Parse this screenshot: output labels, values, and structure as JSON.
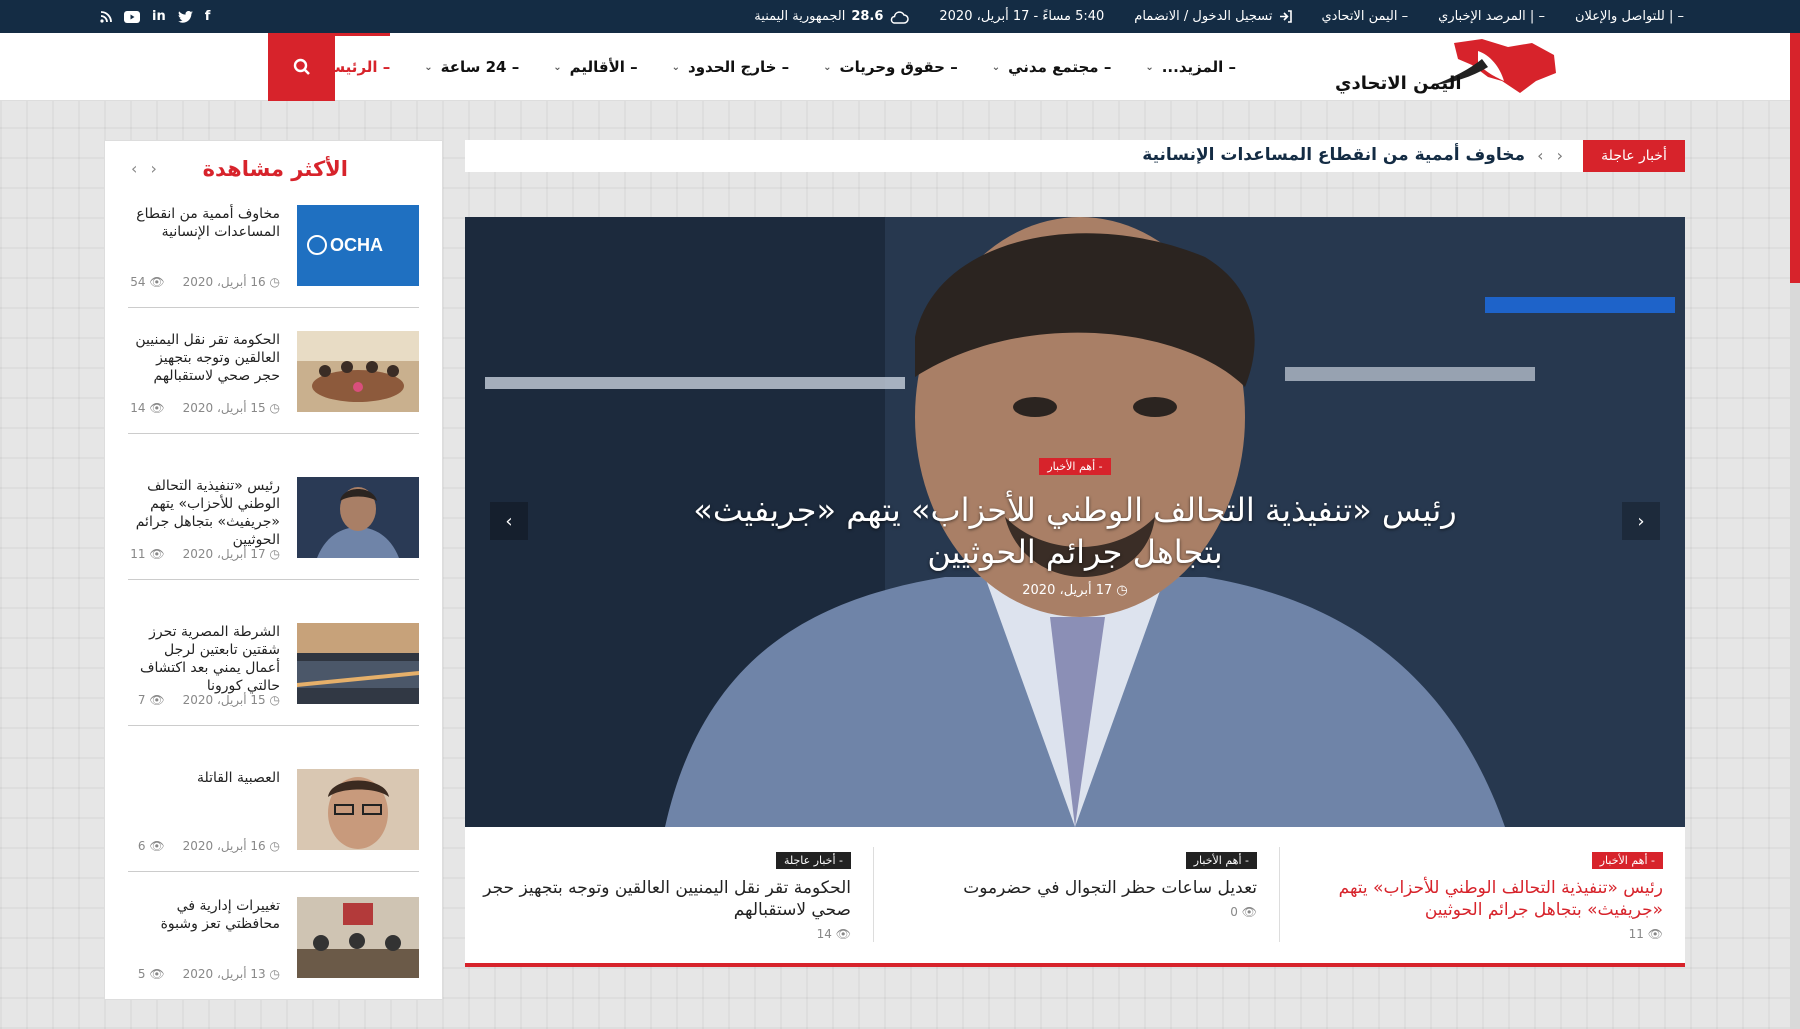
{
  "topbar": {
    "weather": "28.6",
    "region": "الجمهورية اليمنية",
    "datetime": "5:40 مساءً - 17 أبريل، 2020",
    "login": "تسجيل الدخول / الانضمام",
    "links": [
      "– اليمن الاتحادي",
      "– | المرصد الإخباري",
      "– | للتواصل والإعلان"
    ],
    "social_icons": [
      "facebook-icon",
      "twitter-icon",
      "linkedin-icon",
      "youtube-icon",
      "rss-icon"
    ]
  },
  "header": {
    "logo_text": "اليمن الاتحادي",
    "nav": [
      {
        "label": "– الرئيسية",
        "active": true,
        "has_menu": false
      },
      {
        "label": "– 24 ساعة",
        "active": false,
        "has_menu": true
      },
      {
        "label": "– الأقاليم",
        "active": false,
        "has_menu": true
      },
      {
        "label": "– خارج الحدود",
        "active": false,
        "has_menu": true
      },
      {
        "label": "– حقوق وحريات",
        "active": false,
        "has_menu": true
      },
      {
        "label": "– مجتمع مدني",
        "active": false,
        "has_menu": true
      },
      {
        "label": "– المزيد...",
        "active": false,
        "has_menu": true
      }
    ]
  },
  "breaking": {
    "label": "أخبار عاجلة",
    "headline": "مخاوف أممية من انقطاع المساعدات الإنسانية"
  },
  "slider": {
    "category": "- أهم الأخبار",
    "title": "رئيس «تنفيذية التحالف الوطني للأحزاب» يتهم «جريفيث» بتجاهل جرائم الحوثيين",
    "date": "17 أبريل، 2020"
  },
  "strip": [
    {
      "category": "- أهم الأخبار",
      "title": "رئيس «تنفيذية التحالف الوطني للأحزاب» يتهم «جريفيث» بتجاهل جرائم الحوثيين",
      "views": "11"
    },
    {
      "category": "- أهم الأخبار",
      "title": "تعديل ساعات حظر التجوال في حضرموت",
      "views": "0"
    },
    {
      "category": "- أخبار عاجلة",
      "title": "الحكومة تقر نقل اليمنيين العالقين وتوجه بتجهيز حجر صحي لاستقبالهم",
      "views": "14"
    }
  ],
  "sidebar": {
    "title": "الأكثر مشاهدة",
    "items": [
      {
        "title": "مخاوف أممية من انقطاع المساعدات الإنسانية",
        "date": "16 أبريل، 2020",
        "views": "54",
        "thumb_text": "OCHA"
      },
      {
        "title": "الحكومة تقر نقل اليمنيين العالقين وتوجه بتجهيز حجر صحي لاستقبالهم",
        "date": "15 أبريل، 2020",
        "views": "14"
      },
      {
        "title": "رئيس «تنفيذية التحالف الوطني للأحزاب» يتهم «جريفيث» بتجاهل جرائم الحوثيين",
        "date": "17 أبريل، 2020",
        "views": "11"
      },
      {
        "title": "الشرطة المصرية تحرز شقتين تابعتين لرجل أعمال يمني بعد اكتشاف حالتي كورونا",
        "date": "15 أبريل، 2020",
        "views": "7"
      },
      {
        "title": "العصبية القاتلة",
        "date": "16 أبريل، 2020",
        "views": "6"
      },
      {
        "title": "تغييرات إدارية في محافظتي تعز وشبوة",
        "date": "13 أبريل، 2020",
        "views": "5"
      }
    ]
  },
  "colors": {
    "accent": "#d7232b",
    "navy": "#142c44"
  }
}
